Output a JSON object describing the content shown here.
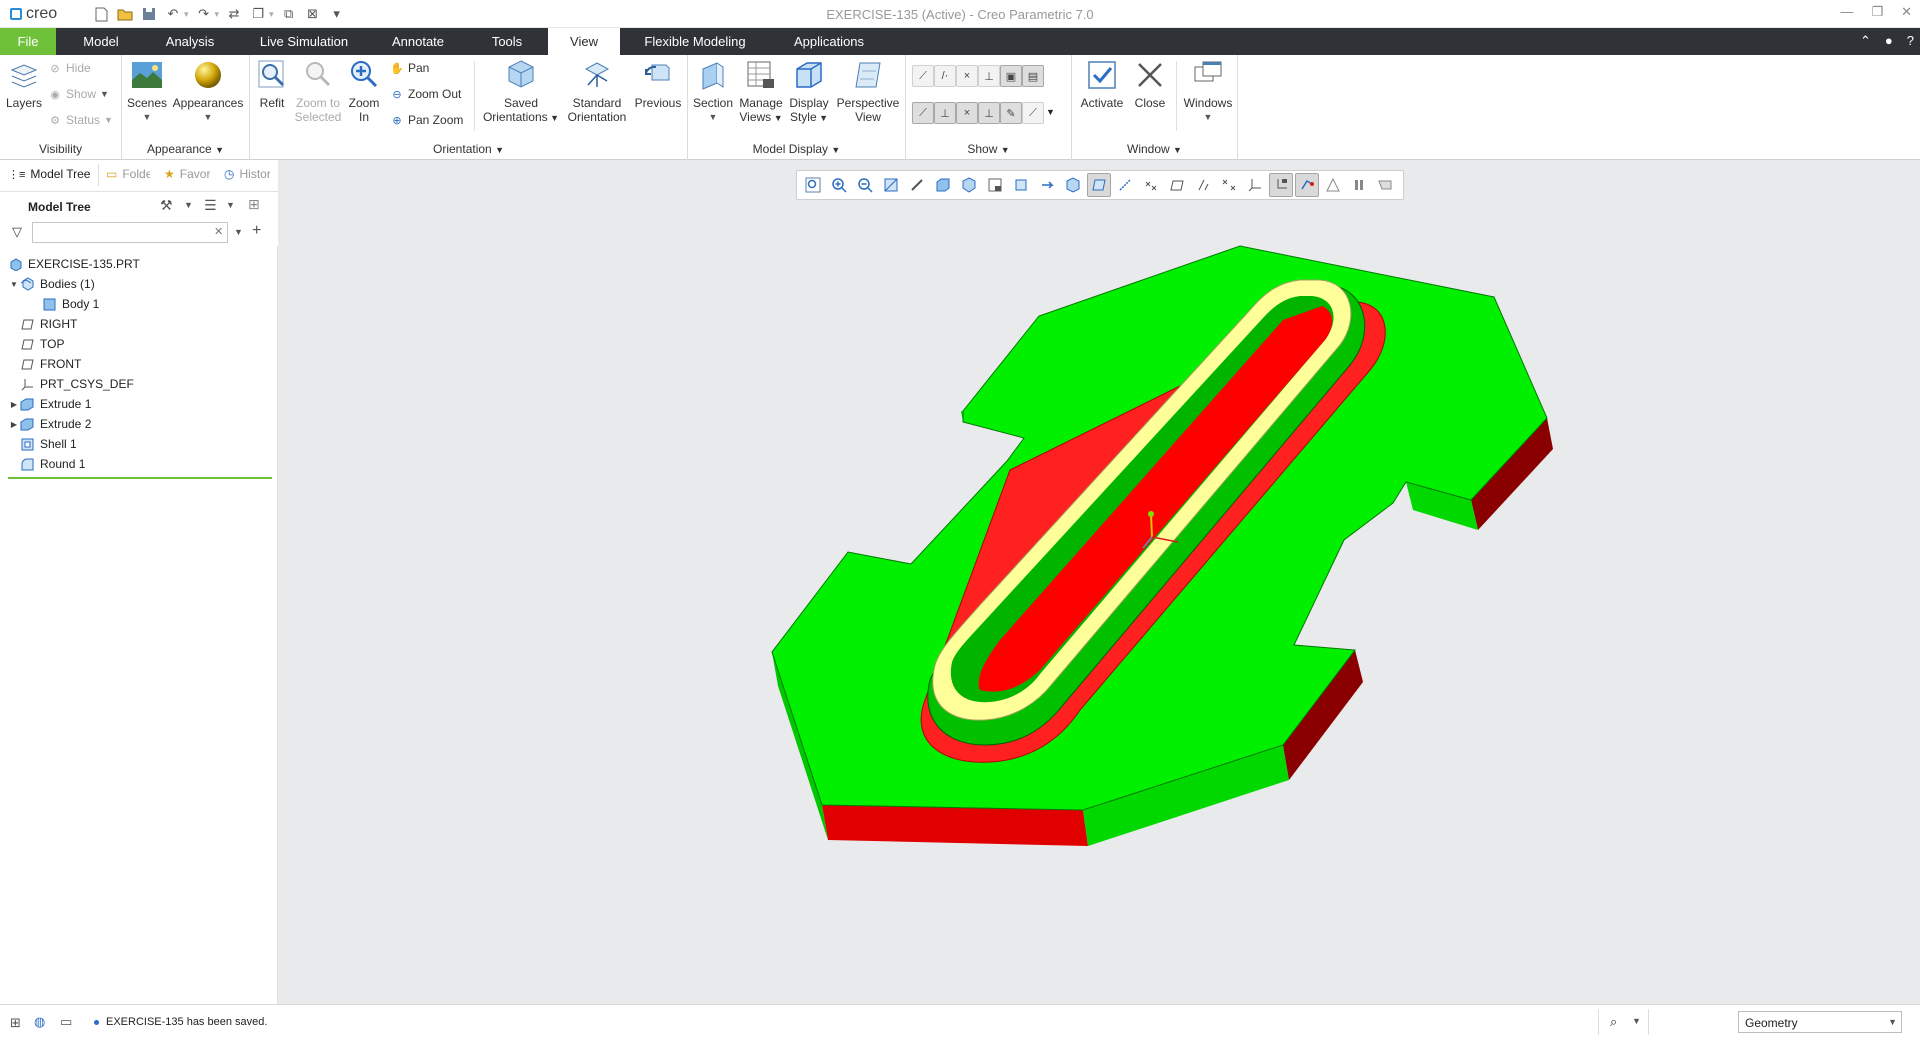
{
  "app": {
    "logo": "creo",
    "window_title": "EXERCISE-135 (Active) - Creo Parametric 7.0",
    "window_controls": [
      "minimize-icon",
      "restore-icon",
      "close-icon"
    ]
  },
  "tabs": [
    {
      "label": "File",
      "active": false
    },
    {
      "label": "Model",
      "active": false
    },
    {
      "label": "Analysis",
      "active": false
    },
    {
      "label": "Live Simulation",
      "active": false
    },
    {
      "label": "Annotate",
      "active": false
    },
    {
      "label": "Tools",
      "active": false
    },
    {
      "label": "View",
      "active": true
    },
    {
      "label": "Flexible Modeling",
      "active": false
    },
    {
      "label": "Applications",
      "active": false
    }
  ],
  "ribbon": {
    "visibility": {
      "group": "Visibility",
      "layers": "Layers",
      "hide": "Hide",
      "show": "Show",
      "status": "Status"
    },
    "appearance": {
      "group": "Appearance",
      "scenes": "Scenes",
      "appearances": "Appearances"
    },
    "orientation": {
      "group": "Orientation",
      "refit": "Refit",
      "zoom_selected_1": "Zoom to",
      "zoom_selected_2": "Selected",
      "zoom_in_1": "Zoom",
      "zoom_in_2": "In",
      "pan": "Pan",
      "zoom_out": "Zoom Out",
      "pan_zoom": "Pan Zoom",
      "saved_1": "Saved",
      "saved_2": "Orientations",
      "standard_1": "Standard",
      "standard_2": "Orientation",
      "previous": "Previous"
    },
    "model_display": {
      "group": "Model Display",
      "section": "Section",
      "manage_1": "Manage",
      "manage_2": "Views",
      "display_1": "Display",
      "display_2": "Style",
      "perspective_1": "Perspective",
      "perspective_2": "View"
    },
    "show": {
      "group": "Show"
    },
    "window": {
      "group": "Window",
      "activate": "Activate",
      "close": "Close",
      "windows": "Windows"
    }
  },
  "navigator": {
    "tabs": [
      "Model Tree",
      "Folder Browser",
      "Favorites",
      "History"
    ],
    "tree_title": "Model Tree",
    "search_value": ""
  },
  "tree": [
    {
      "label": "EXERCISE-135.PRT",
      "icon": "part-icon",
      "expander": ""
    },
    {
      "label": "Bodies (1)",
      "icon": "bodies-icon",
      "expander": "▼"
    },
    {
      "label": "Body 1",
      "icon": "body-icon",
      "expander": ""
    },
    {
      "label": "RIGHT",
      "icon": "datum-plane-icon",
      "expander": ""
    },
    {
      "label": "TOP",
      "icon": "datum-plane-icon",
      "expander": ""
    },
    {
      "label": "FRONT",
      "icon": "datum-plane-icon",
      "expander": ""
    },
    {
      "label": "PRT_CSYS_DEF",
      "icon": "csys-icon",
      "expander": ""
    },
    {
      "label": "Extrude 1",
      "icon": "extrude-icon",
      "expander": "▶"
    },
    {
      "label": "Extrude 2",
      "icon": "extrude-icon",
      "expander": "▶"
    },
    {
      "label": "Shell 1",
      "icon": "shell-icon",
      "expander": ""
    },
    {
      "label": "Round 1",
      "icon": "round-icon",
      "expander": ""
    }
  ],
  "status": {
    "message": "EXERCISE-135 has been saved.",
    "filter": "Geometry"
  },
  "colors": {
    "accent_green": "#6fc13a",
    "model_green": "#00f000",
    "model_red": "#ee0000",
    "model_yellow": "#ffff9a",
    "tabbar": "#2f3236"
  }
}
